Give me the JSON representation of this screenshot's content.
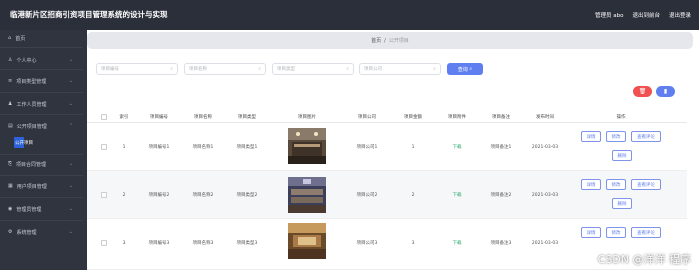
{
  "header": {
    "title": "临港新片区招商引资项目管理系统的设计与实现",
    "user": "管理员 abo",
    "back": "退出到前台",
    "logout": "退出登录"
  },
  "sidebar": {
    "items": [
      {
        "label": "首页",
        "icon": "home-icon"
      },
      {
        "label": "个人中心",
        "icon": "user-icon"
      },
      {
        "label": "项目类型管理",
        "icon": "list-icon"
      },
      {
        "label": "工作人员管理",
        "icon": "people-icon"
      },
      {
        "label": "公开项目管理",
        "icon": "folder-icon"
      },
      {
        "label": "项目合同管理",
        "icon": "doc-icon"
      },
      {
        "label": "用户项目管理",
        "icon": "grid-icon"
      },
      {
        "label": "管理员管理",
        "icon": "admin-icon"
      },
      {
        "label": "系统管理",
        "icon": "settings-icon"
      }
    ],
    "sub": "公开项目"
  },
  "breadcrumb": {
    "home": "首页",
    "sep": "/",
    "current": "公开项目"
  },
  "search": {
    "p1": "项目编号",
    "p2": "项目名称",
    "p3": "项目类型",
    "p4": "项目公司",
    "button": "查询"
  },
  "table": {
    "headers": [
      "索引",
      "项目编号",
      "项目名称",
      "项目类型",
      "项目图片",
      "项目公司",
      "项目金额",
      "项目附件",
      "项目备注",
      "发布时间",
      "操作"
    ],
    "rows": [
      {
        "idx": "1",
        "code": "项目编号1",
        "name": "项目名称1",
        "type": "项目类型1",
        "company": "项目公司1",
        "amount": "1",
        "attach": "下载",
        "note": "项目备注1",
        "date": "2021-03-03"
      },
      {
        "idx": "2",
        "code": "项目编号2",
        "name": "项目名称2",
        "type": "项目类型2",
        "company": "项目公司2",
        "amount": "2",
        "attach": "下载",
        "note": "项目备注2",
        "date": "2021-03-03"
      },
      {
        "idx": "3",
        "code": "项目编号3",
        "name": "项目名称3",
        "type": "项目类型3",
        "company": "项目公司3",
        "amount": "3",
        "attach": "下载",
        "note": "项目备注3",
        "date": "2021-03-03"
      }
    ],
    "ops": {
      "detail": "详情",
      "edit": "修改",
      "review": "查看评论",
      "delete": "删除"
    }
  },
  "watermark": "CSDN @洋洋 程序",
  "colors": {
    "primary": "#5f7ff0",
    "danger": "#f05050",
    "sidebar": "#30343f"
  }
}
